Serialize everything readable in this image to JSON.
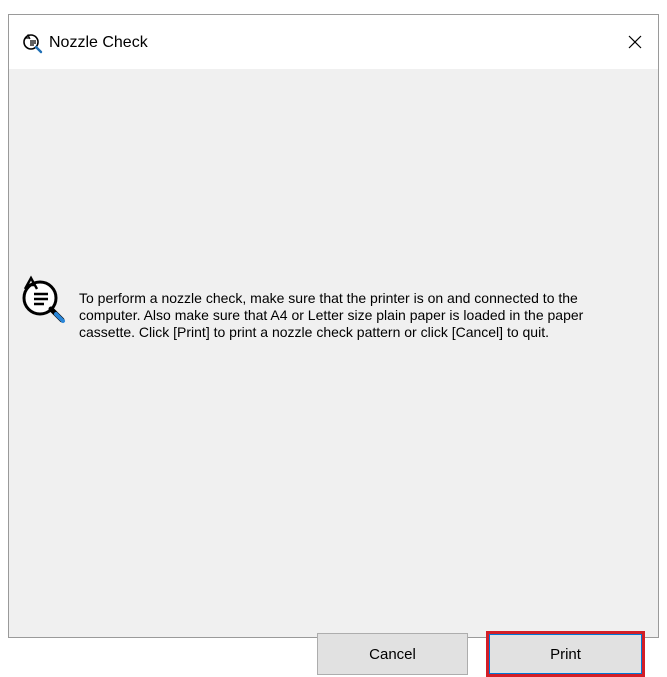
{
  "window": {
    "title": "Nozzle Check",
    "title_icon": "nozzle-check-printer-icon",
    "close_icon": "close-icon"
  },
  "message": {
    "icon": "nozzle-check-magnifier-icon",
    "text": "To perform a nozzle check, make sure that the printer is on and connected to the computer. Also make sure that A4 or Letter size plain paper is loaded in the paper cassette. Click [Print] to print a nozzle check pattern or click [Cancel] to quit."
  },
  "buttons": {
    "cancel_label": "Cancel",
    "print_label": "Print"
  },
  "colors": {
    "dialog_background": "#f0f0f0",
    "titlebar_background": "#ffffff",
    "highlight_border": "#d21f28",
    "focus_border": "#0078d7"
  }
}
